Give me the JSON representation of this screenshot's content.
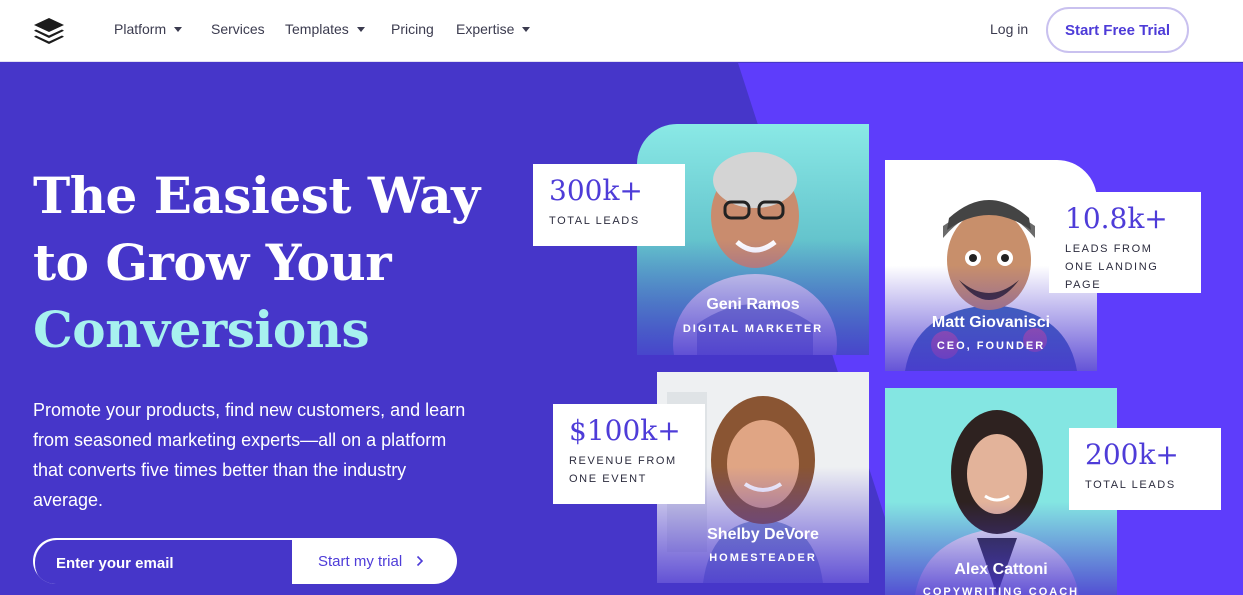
{
  "nav": {
    "items": [
      {
        "label": "Platform",
        "dropdown": true
      },
      {
        "label": "Services",
        "dropdown": false
      },
      {
        "label": "Templates",
        "dropdown": true
      },
      {
        "label": "Pricing",
        "dropdown": false
      },
      {
        "label": "Expertise",
        "dropdown": true
      }
    ],
    "login": "Log in",
    "cta": "Start Free Trial"
  },
  "hero": {
    "headline": [
      "The Easiest Way",
      "to Grow Your",
      "Conversions"
    ],
    "subtext": "Promote your products, find new customers, and learn from seasoned marketing experts—all on a platform that converts five times better than the industry average.",
    "email_placeholder": "Enter your email",
    "submit_label": "Start my trial"
  },
  "people": [
    {
      "name": "Geni Ramos",
      "role": "DIGITAL MARKETER"
    },
    {
      "name": "Matt Giovanisci",
      "role": "CEO, FOUNDER"
    },
    {
      "name": "Shelby DeVore",
      "role": "HOMESTEADER"
    },
    {
      "name": "Alex Cattoni",
      "role": "COPYWRITING COACH"
    }
  ],
  "stats": [
    {
      "value": "300k+",
      "label": "TOTAL LEADS"
    },
    {
      "value": "10.8k+",
      "label": "LEADS FROM ONE LANDING PAGE"
    },
    {
      "value": "$100k+",
      "label": "REVENUE FROM ONE EVENT"
    },
    {
      "value": "200k+",
      "label": "TOTAL LEADS"
    }
  ],
  "colors": {
    "hero_bg": "#4636c9",
    "hero_bg_light": "#5e3dfb",
    "accent_text": "#a7f1ef",
    "brand": "#4e3cd8",
    "card_teal": "#7fe6e4"
  },
  "icons": {
    "logo": "stacked-layers-logo",
    "caret": "caret-down-icon",
    "arrow": "chevron-right-icon"
  }
}
